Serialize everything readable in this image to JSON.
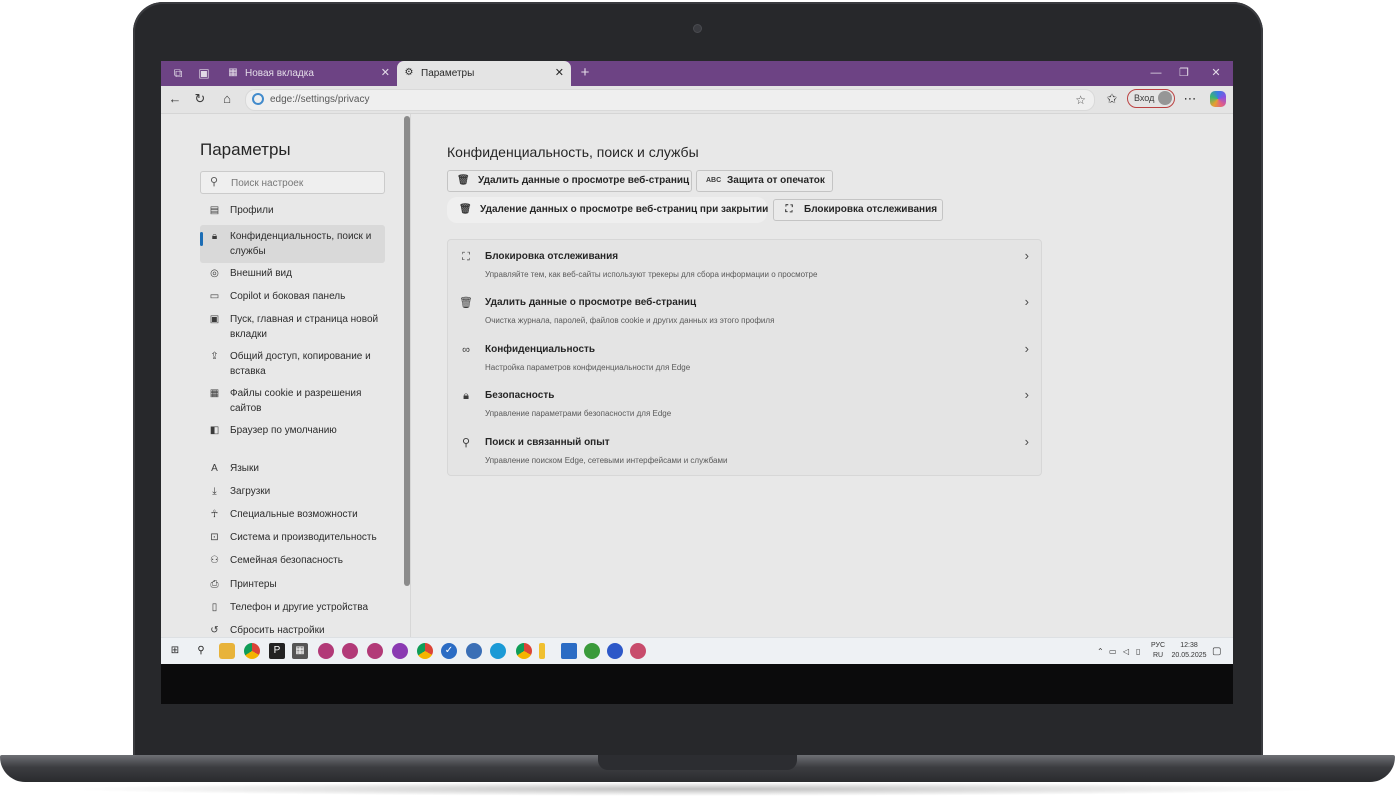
{
  "tabs": [
    {
      "label": "Новая вкладка",
      "active": false
    },
    {
      "label": "Параметры",
      "active": true
    }
  ],
  "address": {
    "url": "edge://settings/privacy"
  },
  "profile": {
    "signin_label": "Вход"
  },
  "sidebar": {
    "title": "Параметры",
    "search_placeholder": "Поиск настроек",
    "items": [
      {
        "label": "Профили",
        "icon": "profile-icon"
      },
      {
        "label": "Конфиденциальность, поиск и службы",
        "icon": "lock-icon",
        "active": true
      },
      {
        "label": "Внешний вид",
        "icon": "appearance-icon"
      },
      {
        "label": "Copilot и боковая панель",
        "icon": "sidebar-icon"
      },
      {
        "label": "Пуск, главная и страница новой вкладки",
        "icon": "home-page-icon"
      },
      {
        "label": "Общий доступ, копирование и вставка",
        "icon": "share-icon"
      },
      {
        "label": "Файлы cookie и разрешения сайтов",
        "icon": "cookie-icon"
      },
      {
        "label": "Браузер по умолчанию",
        "icon": "browser-icon"
      },
      {
        "label": "Языки",
        "icon": "language-icon"
      },
      {
        "label": "Загрузки",
        "icon": "download-icon"
      },
      {
        "label": "Специальные возможности",
        "icon": "accessibility-icon"
      },
      {
        "label": "Система и производительность",
        "icon": "system-icon"
      },
      {
        "label": "Семейная безопасность",
        "icon": "family-icon"
      },
      {
        "label": "Принтеры",
        "icon": "printer-icon"
      },
      {
        "label": "Телефон и другие устройства",
        "icon": "phone-icon"
      },
      {
        "label": "Сбросить настройки",
        "icon": "reset-icon"
      }
    ]
  },
  "main": {
    "title": "Конфиденциальность, поиск и службы",
    "chips": [
      {
        "label": "Удалить данные о просмотре веб-страниц",
        "icon": "trash-icon"
      },
      {
        "label": "Защита от опечаток",
        "icon": "spellcheck-icon"
      },
      {
        "label": "Удаление данных о просмотре веб-страниц при закрытии",
        "icon": "trash-clock-icon",
        "highlighted": true
      },
      {
        "label": "Блокировка отслеживания",
        "icon": "tracking-icon"
      }
    ],
    "rows": [
      {
        "title": "Блокировка отслеживания",
        "subtitle": "Управляйте тем, как веб-сайты используют трекеры для сбора информации о просмотре",
        "icon": "tracking-icon"
      },
      {
        "title": "Удалить данные о просмотре веб-страниц",
        "subtitle": "Очистка журнала, паролей, файлов cookie и других данных из этого профиля",
        "icon": "trash-icon"
      },
      {
        "title": "Конфиденциальность",
        "subtitle": "Настройка параметров конфиденциальности для Edge",
        "icon": "glasses-icon"
      },
      {
        "title": "Безопасность",
        "subtitle": "Управление параметрами безопасности для Edge",
        "icon": "lock-icon"
      },
      {
        "title": "Поиск и связанный опыт",
        "subtitle": "Управление поиском Edge, сетевыми интерфейсами и службами",
        "icon": "search-icon"
      }
    ]
  },
  "taskbar": {
    "lang_top": "РУС",
    "lang_bottom": "RU",
    "time": "12:38",
    "date": "20.05.2025"
  },
  "colors": {
    "titlebar": "#6b3c86",
    "accent": "#0f6cbd"
  }
}
